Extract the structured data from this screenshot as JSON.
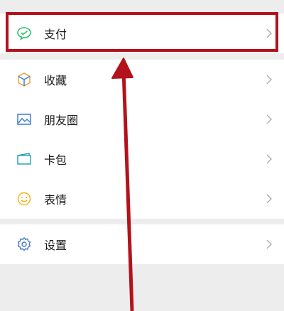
{
  "menu": {
    "items": [
      {
        "label": "支付",
        "icon": "wechat-pay-icon"
      },
      {
        "label": "收藏",
        "icon": "favorites-cube-icon"
      },
      {
        "label": "朋友圈",
        "icon": "moments-picture-icon"
      },
      {
        "label": "卡包",
        "icon": "card-wallet-icon"
      },
      {
        "label": "表情",
        "icon": "sticker-smiley-icon"
      }
    ],
    "settings": {
      "label": "设置",
      "icon": "gear-icon"
    }
  },
  "annotation": {
    "highlight_color": "#b3121c",
    "arrow_color": "#b3121c"
  },
  "colors": {
    "pay_green": "#2fbf6f",
    "favorites_orange": "#e9a23b",
    "moments_blue": "#3f7fd1",
    "card_teal": "#2aa3b8",
    "sticker_yellow": "#f2b51e",
    "settings_blue": "#4a78c7"
  }
}
